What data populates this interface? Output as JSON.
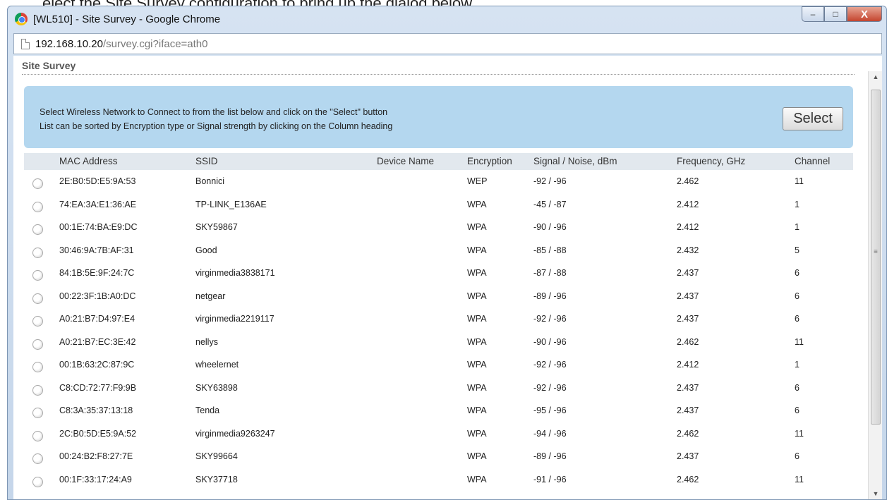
{
  "background_page": {
    "partial_text": "elect the Site Survey configuration to bring up the dialog below.",
    "partial_text_2": ","
  },
  "window": {
    "title": "[WL510] - Site Survey - Google Chrome",
    "controls": {
      "minimize": "–",
      "maximize": "□",
      "close": "X"
    }
  },
  "address": {
    "host": "192.168.10.20",
    "path": "/survey.cgi?iface=ath0"
  },
  "page": {
    "title": "Site Survey",
    "info_line_1": "Select Wireless Network to Connect to from the list below and click on the \"Select\" button",
    "info_line_2": "List can be sorted by Encryption type or Signal strength by clicking on the Column heading",
    "select_label": "Select"
  },
  "table": {
    "headers": {
      "mac": "MAC Address",
      "ssid": "SSID",
      "device": "Device Name",
      "encryption": "Encryption",
      "signal": "Signal / Noise, dBm",
      "frequency": "Frequency, GHz",
      "channel": "Channel"
    },
    "rows": [
      {
        "mac": "2E:B0:5D:E5:9A:53",
        "ssid": "Bonnici",
        "device": "",
        "encryption": "WEP",
        "signal": "-92 / -96",
        "frequency": "2.462",
        "channel": "11"
      },
      {
        "mac": "74:EA:3A:E1:36:AE",
        "ssid": "TP-LINK_E136AE",
        "device": "",
        "encryption": "WPA",
        "signal": "-45 / -87",
        "frequency": "2.412",
        "channel": "1"
      },
      {
        "mac": "00:1E:74:BA:E9:DC",
        "ssid": "SKY59867",
        "device": "",
        "encryption": "WPA",
        "signal": "-90 / -96",
        "frequency": "2.412",
        "channel": "1"
      },
      {
        "mac": "30:46:9A:7B:AF:31",
        "ssid": "Good",
        "device": "",
        "encryption": "WPA",
        "signal": "-85 / -88",
        "frequency": "2.432",
        "channel": "5"
      },
      {
        "mac": "84:1B:5E:9F:24:7C",
        "ssid": "virginmedia3838171",
        "device": "",
        "encryption": "WPA",
        "signal": "-87 / -88",
        "frequency": "2.437",
        "channel": "6"
      },
      {
        "mac": "00:22:3F:1B:A0:DC",
        "ssid": "netgear",
        "device": "",
        "encryption": "WPA",
        "signal": "-89 / -96",
        "frequency": "2.437",
        "channel": "6"
      },
      {
        "mac": "A0:21:B7:D4:97:E4",
        "ssid": "virginmedia2219117",
        "device": "",
        "encryption": "WPA",
        "signal": "-92 / -96",
        "frequency": "2.437",
        "channel": "6"
      },
      {
        "mac": "A0:21:B7:EC:3E:42",
        "ssid": "nellys",
        "device": "",
        "encryption": "WPA",
        "signal": "-90 / -96",
        "frequency": "2.462",
        "channel": "11"
      },
      {
        "mac": "00:1B:63:2C:87:9C",
        "ssid": "wheelernet",
        "device": "",
        "encryption": "WPA",
        "signal": "-92 / -96",
        "frequency": "2.412",
        "channel": "1"
      },
      {
        "mac": "C8:CD:72:77:F9:9B",
        "ssid": "SKY63898",
        "device": "",
        "encryption": "WPA",
        "signal": "-92 / -96",
        "frequency": "2.437",
        "channel": "6"
      },
      {
        "mac": "C8:3A:35:37:13:18",
        "ssid": "Tenda",
        "device": "",
        "encryption": "WPA",
        "signal": "-95 / -96",
        "frequency": "2.437",
        "channel": "6"
      },
      {
        "mac": "2C:B0:5D:E5:9A:52",
        "ssid": "virginmedia9263247",
        "device": "",
        "encryption": "WPA",
        "signal": "-94 / -96",
        "frequency": "2.462",
        "channel": "11"
      },
      {
        "mac": "00:24:B2:F8:27:7E",
        "ssid": "SKY99664",
        "device": "",
        "encryption": "WPA",
        "signal": "-89 / -96",
        "frequency": "2.437",
        "channel": "6"
      },
      {
        "mac": "00:1F:33:17:24:A9",
        "ssid": "SKY37718",
        "device": "",
        "encryption": "WPA",
        "signal": "-91 / -96",
        "frequency": "2.462",
        "channel": "11"
      }
    ]
  },
  "colors": {
    "info_box": "#b4d7ef",
    "header_row": "#e2e8ee",
    "window_frame": "#c5d6ea",
    "close_button": "#c4452f"
  },
  "icons": {
    "favicon": "chrome-icon",
    "address": "page-icon",
    "radio": "radio-button"
  }
}
